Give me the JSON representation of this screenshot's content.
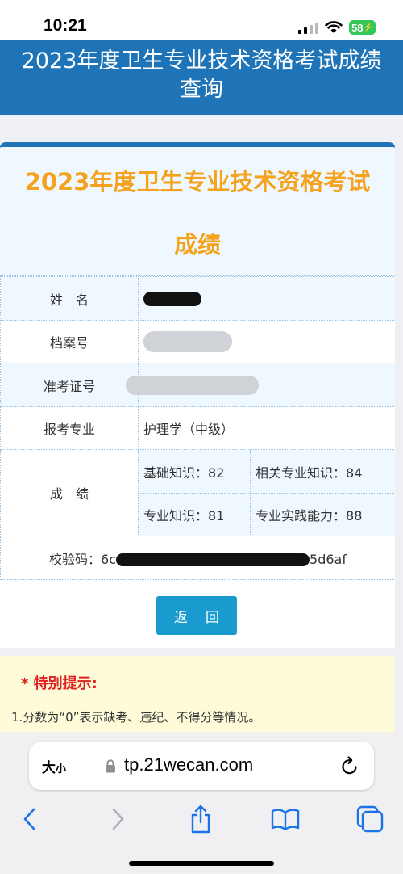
{
  "status_bar": {
    "time": "10:21",
    "battery": "58"
  },
  "page": {
    "header_line1": "2023年度卫生专业技术资格考试成绩",
    "header_line2": "查询"
  },
  "card": {
    "title_line1": "2023年度卫生专业技术资格考试",
    "title_line2": "成绩",
    "rows": {
      "name_label": "姓　名",
      "file_no_label": "档案号",
      "exam_id_label": "准考证号",
      "major_label": "报考专业",
      "major_value": "护理学（中级）",
      "score_label": "成　绩",
      "verify_label": "校验码：",
      "verify_prefix": "6c",
      "verify_suffix": "5d6af"
    },
    "scores": [
      {
        "label": "基础知识：",
        "value": "82"
      },
      {
        "label": "相关专业知识：",
        "value": "84"
      },
      {
        "label": "专业知识：",
        "value": "81"
      },
      {
        "label": "专业实践能力：",
        "value": "88"
      }
    ],
    "return_label": "返回"
  },
  "notice": {
    "title": "* 特别提示:",
    "text": "1.分数为“0”表示缺考、违纪、不得分等情况。"
  },
  "browser": {
    "aa_big": "大",
    "aa_small": "小",
    "url": "tp.21wecan.com"
  },
  "icons": {
    "lock": "lock-icon",
    "reload": "reload-icon",
    "back": "chevron-left-icon",
    "forward": "chevron-right-icon",
    "share": "share-icon",
    "bookmarks": "book-icon",
    "tabs": "tabs-icon"
  },
  "colors": {
    "header_blue": "#1e74b6",
    "title_orange": "#f5a21e",
    "button_blue": "#1a9bd0",
    "notice_red": "#e02020",
    "notice_bg": "#fefbd8"
  }
}
